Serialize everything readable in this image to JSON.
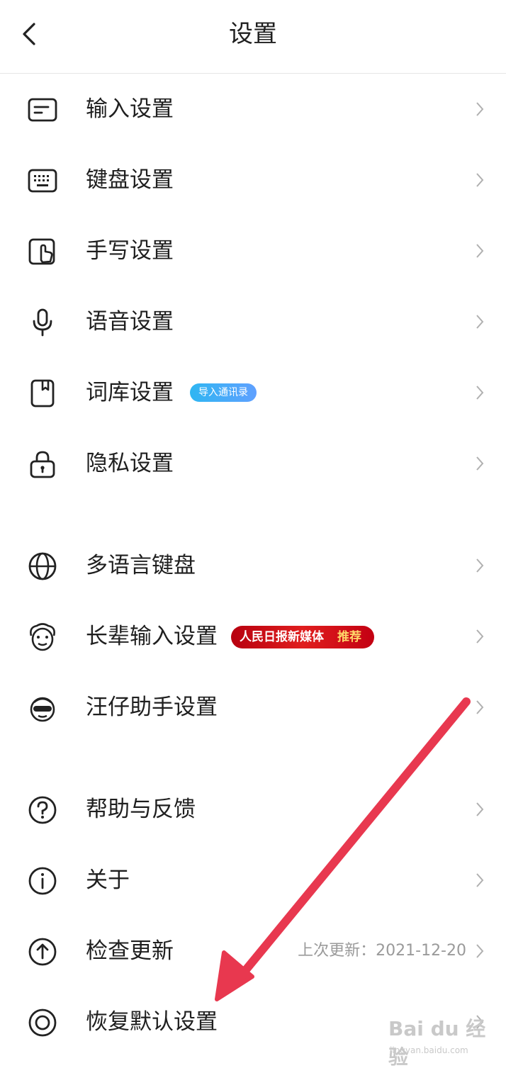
{
  "header": {
    "title": "设置",
    "back_icon": "chevron-left-icon"
  },
  "group1": [
    {
      "label": "输入设置",
      "icon": "input-box-icon"
    },
    {
      "label": "键盘设置",
      "icon": "keyboard-icon"
    },
    {
      "label": "手写设置",
      "icon": "handwriting-icon"
    },
    {
      "label": "语音设置",
      "icon": "microphone-icon"
    },
    {
      "label": "词库设置",
      "icon": "bookmark-book-icon",
      "badge": "导入通讯录"
    },
    {
      "label": "隐私设置",
      "icon": "lock-icon"
    }
  ],
  "group2": [
    {
      "label": "多语言键盘",
      "icon": "globe-icon"
    },
    {
      "label": "长辈输入设置",
      "icon": "elder-face-icon",
      "badge_main": "人民日报新媒体",
      "badge_tag": "推荐"
    },
    {
      "label": "汪仔助手设置",
      "icon": "wangzai-face-icon"
    }
  ],
  "group3": [
    {
      "label": "帮助与反馈",
      "icon": "question-circle-icon"
    },
    {
      "label": "关于",
      "icon": "info-circle-icon"
    },
    {
      "label": "检查更新",
      "icon": "upload-circle-icon",
      "meta": "上次更新：2021-12-20"
    },
    {
      "label": "恢复默认设置",
      "icon": "restore-circle-icon"
    }
  ],
  "annotation": {
    "arrow_color": "#e8384f"
  },
  "watermark": {
    "brand": "Bai du 经验",
    "url": "jingyan.baidu.com"
  },
  "colors": {
    "text": "#1f1f1f",
    "muted": "#9a9a9a",
    "divider": "#e6e6e6",
    "badge_blue": "#3aa8f5",
    "badge_red": "#d3101c"
  }
}
